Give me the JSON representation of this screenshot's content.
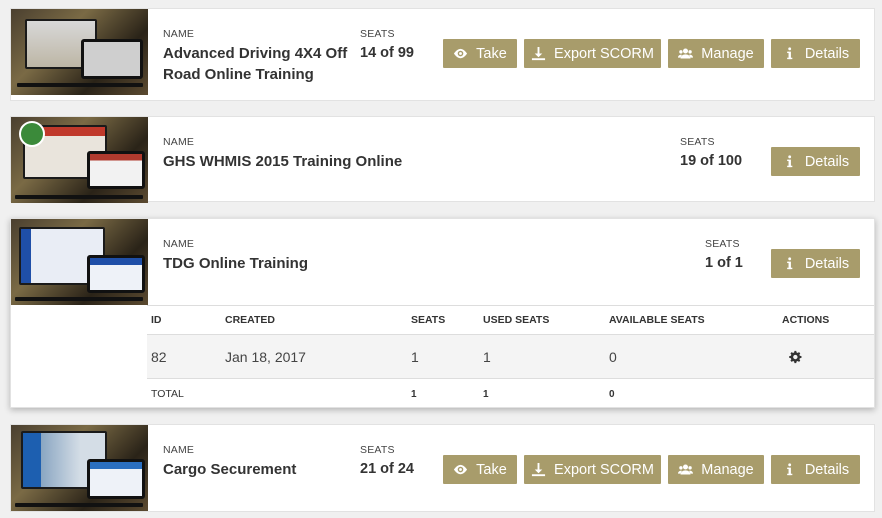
{
  "labels": {
    "name": "NAME",
    "seats": "SEATS"
  },
  "buttons": {
    "take": "Take",
    "export": "Export SCORM",
    "manage": "Manage",
    "details": "Details"
  },
  "courses": [
    {
      "name": "Advanced Driving 4X4 Off Road Online Training",
      "seats": "14 of 99"
    },
    {
      "name": "GHS WHMIS 2015 Training Online",
      "seats": "19 of 100"
    },
    {
      "name": "TDG Online Training",
      "seats": "1 of 1"
    },
    {
      "name": "Cargo Securement",
      "seats": "21 of 24"
    }
  ],
  "table": {
    "headers": [
      "ID",
      "CREATED",
      "SEATS",
      "USED SEATS",
      "AVAILABLE SEATS",
      "ACTIONS"
    ],
    "row": {
      "id": "82",
      "created": "Jan 18, 2017",
      "seats": "1",
      "used": "1",
      "available": "0"
    },
    "total": {
      "label": "TOTAL",
      "seats": "1",
      "used": "1",
      "available": "0"
    }
  },
  "icons": {
    "take": "eye-icon",
    "export": "download-icon",
    "manage": "users-icon",
    "details": "info-icon",
    "action": "gear-icon"
  },
  "colors": {
    "button": "#a89c6b",
    "page_bg": "#f0f0f0"
  }
}
